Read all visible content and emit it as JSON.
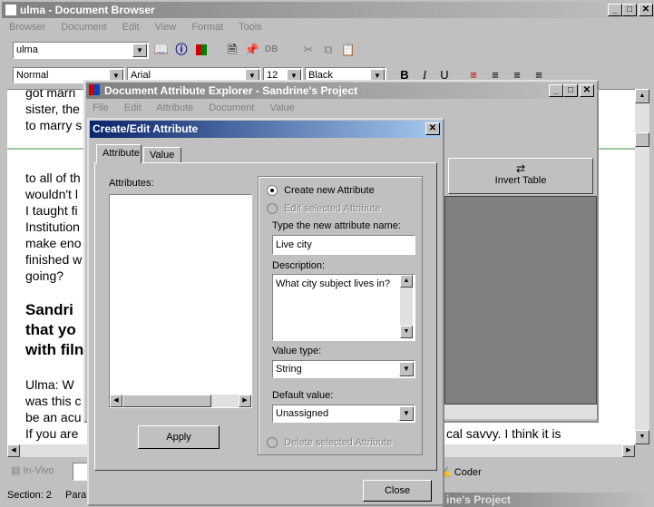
{
  "main_window": {
    "title": "ulma - Document Browser",
    "menu": [
      "Browser",
      "Document",
      "Edit",
      "View",
      "Format",
      "Tools"
    ],
    "document_selector": "ulma",
    "style_value": "Normal",
    "font_value": "Arial",
    "size_value": "12",
    "color_value": "Black",
    "toolbar_format": [
      "B",
      "I",
      "U"
    ],
    "document_lines_top": [
      "got marri",
      "sister, the",
      "to marry s"
    ],
    "document_lines_mid": [
      "to all of th",
      "wouldn't l",
      "I taught fi",
      "Institution",
      "make eno",
      "finished w",
      "going?"
    ],
    "document_heading": [
      "Sandri",
      "that yo",
      "with filn"
    ],
    "document_lines_bottom": [
      "Ulma:  W",
      "was this c",
      "be an acu",
      "If you are"
    ],
    "document_fragment_right": "cal savvy.  I think it is",
    "status_invivo": "In-Vivo",
    "status_coder": "Coder",
    "status_section": "Section: 2",
    "status_para": "Para",
    "background_title_fragment": "ine's Project"
  },
  "explorer_window": {
    "title": "Document Attribute Explorer - Sandrine's Project",
    "menu": [
      "File",
      "Edit",
      "Attribute",
      "Document",
      "Value"
    ],
    "invert_table": "Invert Table"
  },
  "dialog": {
    "title": "Create/Edit Attribute",
    "tabs": [
      "Attribute",
      "Value"
    ],
    "attributes_label": "Attributes:",
    "apply_label": "Apply",
    "create_new": "Create new Attribute",
    "edit_selected": "Edit selected Attribute",
    "name_label": "Type the new attribute name:",
    "name_value": "Live city",
    "description_label": "Description:",
    "description_value": "What city subject lives in?",
    "value_type_label": "Value type:",
    "value_type_value": "String",
    "default_value_label": "Default value:",
    "default_value_value": "Unassigned",
    "delete_selected": "Delete selected Attribute",
    "close_label": "Close"
  }
}
